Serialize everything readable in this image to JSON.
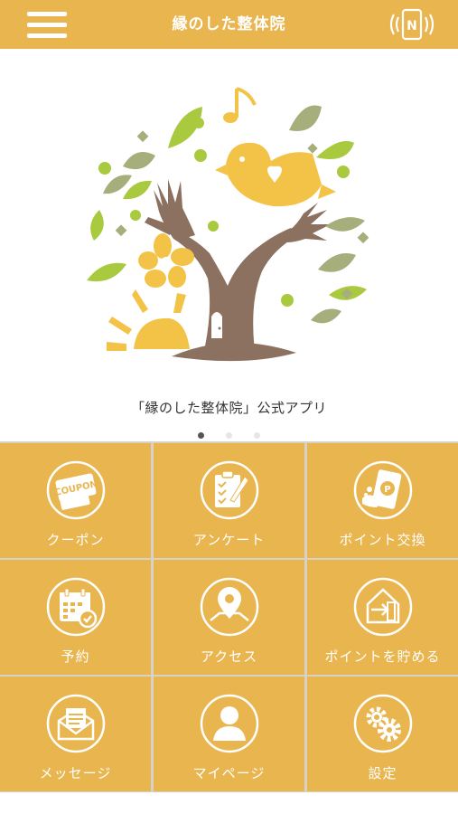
{
  "header": {
    "title": "縁のした整体院",
    "nfc_letter": "N"
  },
  "hero": {
    "caption": "「縁のした整体院」公式アプリ",
    "slides": 3,
    "active_slide": 1
  },
  "menu": [
    {
      "label": "クーポン",
      "icon": "coupon-icon",
      "badge": "COUPON"
    },
    {
      "label": "アンケート",
      "icon": "survey-icon"
    },
    {
      "label": "ポイント交換",
      "icon": "point-exchange-icon",
      "badge": "P"
    },
    {
      "label": "予約",
      "icon": "calendar-icon"
    },
    {
      "label": "アクセス",
      "icon": "map-pin-icon"
    },
    {
      "label": "ポイントを貯める",
      "icon": "check-in-icon"
    },
    {
      "label": "メッセージ",
      "icon": "mail-icon"
    },
    {
      "label": "マイページ",
      "icon": "user-icon"
    },
    {
      "label": "設定",
      "icon": "gear-icon"
    }
  ],
  "colors": {
    "accent": "#e9b54f",
    "divider": "#d7d2c8",
    "trunk": "#8c7160",
    "leaf_green": "#a9c93f",
    "leaf_olive": "#a6ae7c",
    "bird_yellow": "#f3c347"
  }
}
